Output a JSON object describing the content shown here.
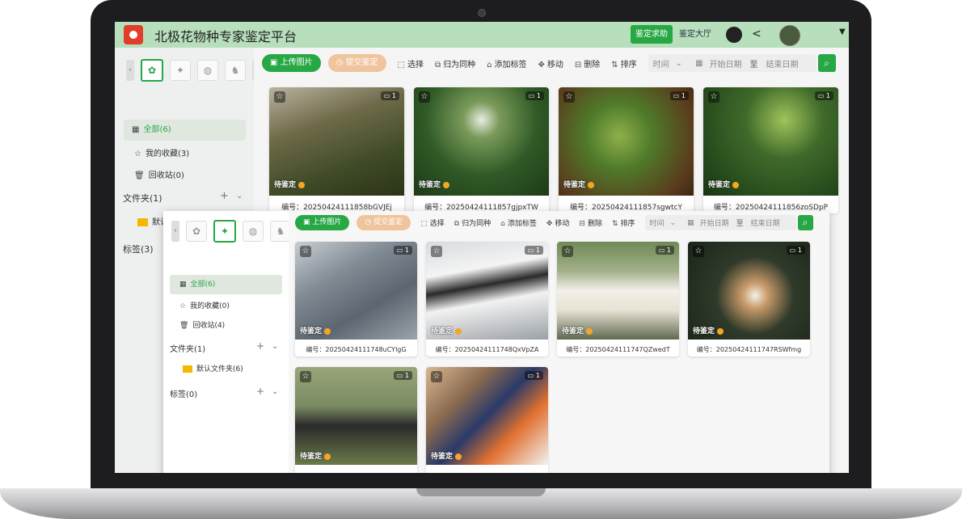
{
  "app": {
    "title": "北极花物种专家鉴定平台",
    "header_buttons": [
      "鉴定求助",
      "鉴定大厅"
    ],
    "accent": "#28a745",
    "header_bg": "#b7dfbc"
  },
  "back": {
    "sidebar": {
      "categories": [
        "植物",
        "鸟",
        "菌",
        "兽"
      ],
      "active_category": 0,
      "items": [
        {
          "label": "全部(6)",
          "icon": "grid-icon"
        },
        {
          "label": "我的收藏(3)",
          "icon": "star-icon"
        },
        {
          "label": "回收站(0)",
          "icon": "trash-icon"
        }
      ],
      "folders_label": "文件夹(1)",
      "default_folder": "默认文件夹(6)",
      "tags_label": "标签(3)"
    },
    "toolbar": {
      "upload": "上传图片",
      "submit": "提交鉴定",
      "tools": [
        "选择",
        "归为同种",
        "添加标签",
        "移动",
        "删除",
        "排序"
      ],
      "time_select": "时间",
      "start_date": "开始日期",
      "to": "至",
      "end_date": "结束日期"
    },
    "cards": [
      {
        "id": "编号：20250424111858bGVJEj",
        "status": "待鉴定",
        "count": "1",
        "color": "#5a6a3e"
      },
      {
        "id": "编号：20250424111857gjpxTW",
        "status": "待鉴定",
        "count": "1",
        "color": "#3e6b2e"
      },
      {
        "id": "编号：20250424111857sgwtcY",
        "status": "待鉴定",
        "count": "1",
        "color": "#4a6a2a"
      },
      {
        "id": "编号：20250424111856zoSDpP",
        "status": "待鉴定",
        "count": "1",
        "color": "#2f5a2a"
      }
    ]
  },
  "front": {
    "sidebar": {
      "categories": [
        "植物",
        "鸟",
        "菌",
        "兽"
      ],
      "active_category": 1,
      "items": [
        {
          "label": "全部(6)",
          "icon": "grid-icon"
        },
        {
          "label": "我的收藏(0)",
          "icon": "star-icon"
        },
        {
          "label": "回收站(4)",
          "icon": "trash-icon"
        }
      ],
      "folders_label": "文件夹(1)",
      "default_folder": "默认文件夹(6)",
      "tags_label": "标签(0)"
    },
    "toolbar": {
      "upload": "上传图片",
      "submit": "提交鉴定",
      "tools": [
        "选择",
        "归为同种",
        "添加标签",
        "移动",
        "删除",
        "排序"
      ],
      "time_select": "时间",
      "start_date": "开始日期",
      "to": "至",
      "end_date": "结束日期"
    },
    "cards": [
      {
        "id": "编号：20250424111748uCYlgG",
        "status": "待鉴定",
        "count": "1",
        "color": "#7f8a93"
      },
      {
        "id": "编号：20250424111748QxVpZA",
        "status": "待鉴定",
        "count": "1",
        "color": "#8a8f94"
      },
      {
        "id": "编号：20250424111747QZwedT",
        "status": "待鉴定",
        "count": "1",
        "color": "#6e8a55"
      },
      {
        "id": "编号：20250424111747RSWfmg",
        "status": "待鉴定",
        "count": "1",
        "color": "#3a4a34"
      },
      {
        "id": "",
        "status": "待鉴定",
        "count": "1",
        "color": "#7a8a62"
      },
      {
        "id": "",
        "status": "待鉴定",
        "count": "1",
        "color": "#8a6a50"
      }
    ]
  }
}
